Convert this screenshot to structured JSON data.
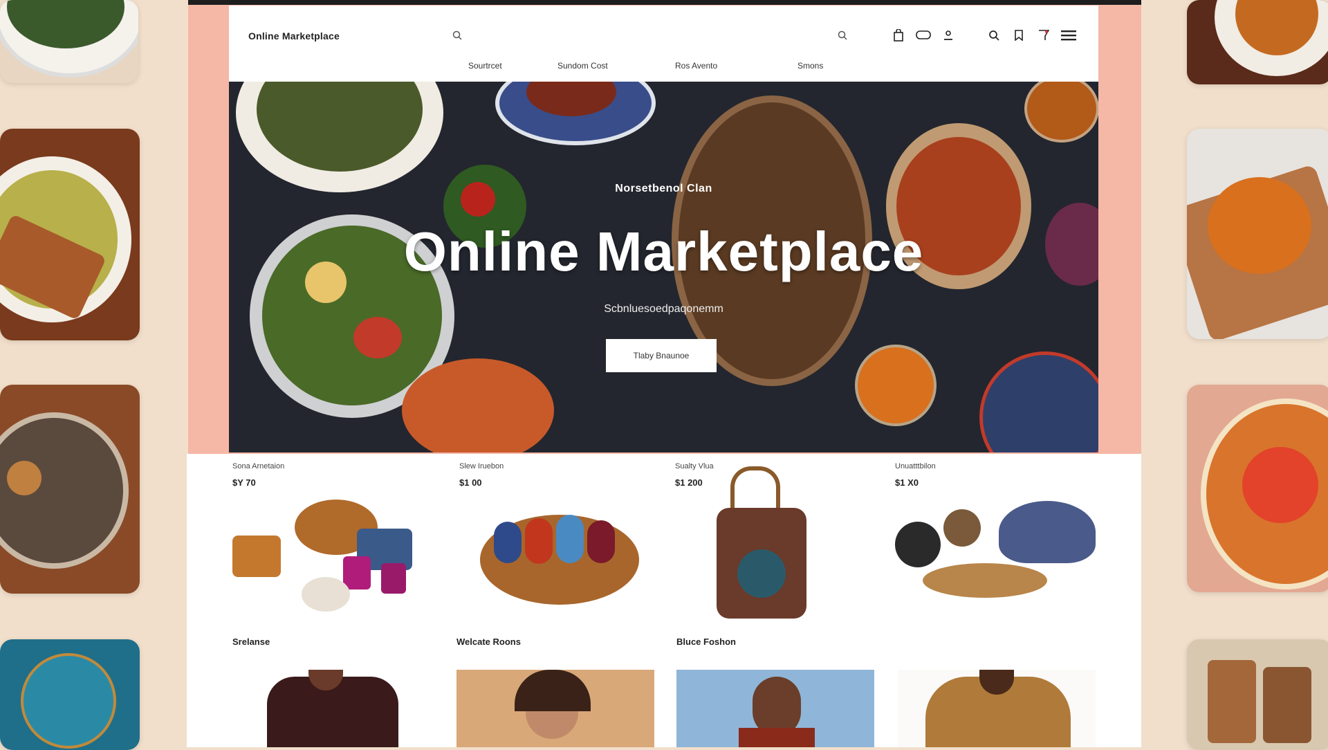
{
  "header": {
    "logo": "Online Marketplace",
    "nav": [
      "Sourtrcet",
      "Sundom Cost",
      "Ros Avento",
      "Smons"
    ],
    "icons": [
      "search-icon",
      "bag-icon",
      "chat-icon",
      "user-icon",
      "search-icon",
      "bookmark-icon",
      "cart-icon",
      "menu-icon"
    ]
  },
  "hero": {
    "kicker": "Norsetbenol Clan",
    "title": "Online Marketplace",
    "subtitle": "Scbnluesoedpaqonemm",
    "button": "Tlaby Bnaunoe"
  },
  "products": [
    {
      "name": "Sona Arnetaion",
      "price": "$Y 70"
    },
    {
      "name": "Slew Iruebon",
      "price": "$1 00"
    },
    {
      "name": "Sualty Vlua",
      "price": "$1 200"
    },
    {
      "name": "Unuatttbilon",
      "price": "$1 X0"
    }
  ],
  "categories": [
    "Srelanse",
    "Welcate Roons",
    "Bluce Foshon"
  ],
  "colors": {
    "accent_pink": "#f5b7a6",
    "page_bg": "#f1dfcb",
    "hero_bg": "#23262e"
  }
}
